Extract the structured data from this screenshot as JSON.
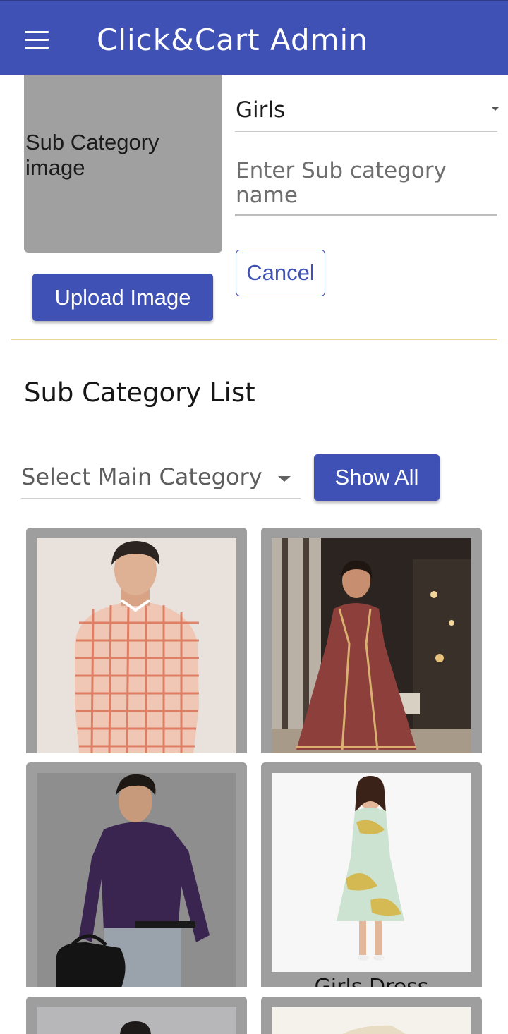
{
  "app_bar": {
    "title": "Click&Cart Admin",
    "menu_icon": "menu-icon",
    "color": "#3f51b5"
  },
  "form": {
    "image_placeholder": "Sub Category image",
    "upload_button": "Upload Image",
    "main_category_selected": "Girls",
    "name_placeholder": "Enter Sub category name",
    "cancel_button": "Cancel"
  },
  "list": {
    "title": "Sub Category List",
    "filter_placeholder": "Select Main Category",
    "show_all_button": "Show All",
    "cards": [
      {
        "image": "boy-checked-shirt-photo",
        "caption": ""
      },
      {
        "image": "girl-maroon-anarkali-dress-photo",
        "caption": ""
      },
      {
        "image": "man-purple-formal-shirt-photo",
        "caption": ""
      },
      {
        "image": "girl-yellow-printed-frock-photo",
        "caption": "Girls Dress"
      },
      {
        "image": "woman-dark-hair-photo",
        "caption": ""
      },
      {
        "image": "cream-garment-photo",
        "caption": ""
      }
    ]
  },
  "colors": {
    "primary": "#3f51b5",
    "card_frame": "#9e9e9e",
    "divider": "#ecd49c"
  }
}
